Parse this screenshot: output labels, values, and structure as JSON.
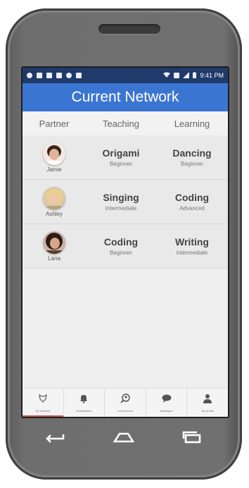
{
  "status_bar": {
    "time": "9:41 PM",
    "left_icons": [
      "dot-icon",
      "image-icon",
      "settings-icon",
      "android-icon",
      "shield-icon",
      "clipboard-icon"
    ],
    "right_icons": [
      "wifi-icon",
      "nfc-icon",
      "signal-icon",
      "battery-icon"
    ]
  },
  "app_bar": {
    "title": "Current Network"
  },
  "columns": {
    "partner": "Partner",
    "teaching": "Teaching",
    "learning": "Learning"
  },
  "rows": [
    {
      "partner": "Jamie",
      "teaching": {
        "skill": "Origami",
        "level": "Beginner"
      },
      "learning": {
        "skill": "Dancing",
        "level": "Beginner"
      }
    },
    {
      "partner": "Ashley",
      "teaching": {
        "skill": "Singing",
        "level": "Intermediate"
      },
      "learning": {
        "skill": "Coding",
        "level": "Advanced"
      }
    },
    {
      "partner": "Lana",
      "teaching": {
        "skill": "Coding",
        "level": "Beginner"
      },
      "learning": {
        "skill": "Writing",
        "level": "Intermediate"
      }
    }
  ],
  "tabs": [
    {
      "label": "My Network",
      "icon": "network-icon",
      "active": true
    },
    {
      "label": "Notifications",
      "icon": "bell-icon",
      "active": false
    },
    {
      "label": "Learn/Teach",
      "icon": "search-person-icon",
      "active": false
    },
    {
      "label": "Messages",
      "icon": "chat-icon",
      "active": false
    },
    {
      "label": "My profile",
      "icon": "person-icon",
      "active": false
    }
  ],
  "colors": {
    "app_bar": "#3a75d1",
    "status_bar": "#1f3a6b",
    "active_tab": "#c95757"
  }
}
